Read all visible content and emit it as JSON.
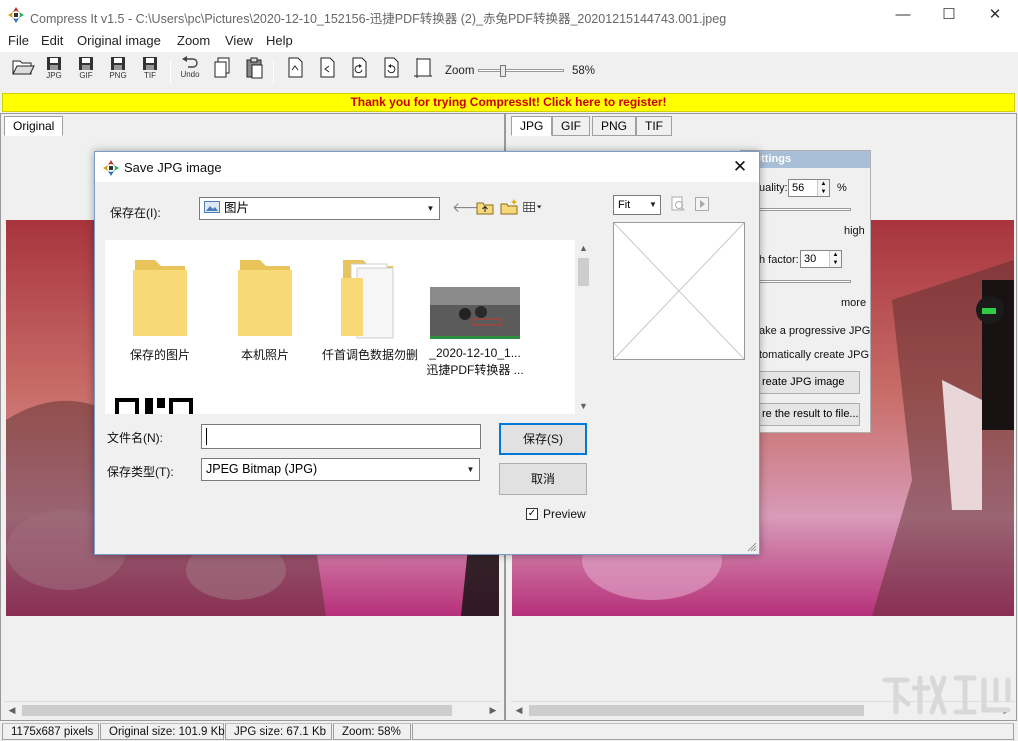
{
  "window": {
    "title": "Compress It v1.5 - C:\\Users\\pc\\Pictures\\2020-12-10_152156-迅捷PDF转换器 (2)_赤兔PDF转换器_20201215144743.001.jpeg",
    "minimize_glyph": "—",
    "maximize_glyph": "☐",
    "close_glyph": "✕"
  },
  "menu": {
    "items": [
      "File",
      "Edit",
      "Original image",
      "Zoom",
      "View",
      "Help"
    ]
  },
  "toolbar": {
    "buttons": [
      {
        "icon": "open-folder-icon",
        "label": ""
      },
      {
        "icon": "save-jpg-icon",
        "label": "JPG"
      },
      {
        "icon": "save-gif-icon",
        "label": "GIF"
      },
      {
        "icon": "save-png-icon",
        "label": "PNG"
      },
      {
        "icon": "save-tif-icon",
        "label": "TIF"
      },
      {
        "icon": "undo-icon",
        "label": "Undo"
      },
      {
        "icon": "copy-icon",
        "label": ""
      },
      {
        "icon": "paste-icon",
        "label": ""
      },
      {
        "icon": "flip-icon",
        "label": ""
      },
      {
        "icon": "mirror-icon",
        "label": ""
      },
      {
        "icon": "rotate-left-icon",
        "label": ""
      },
      {
        "icon": "rotate-right-icon",
        "label": ""
      },
      {
        "icon": "crop-icon",
        "label": ""
      }
    ],
    "zoom_label": "Zoom",
    "zoom_value": "58%",
    "zoom_level": 0.58
  },
  "banner": {
    "text": "Thank you for trying CompressIt! Click here to register!"
  },
  "left_pane": {
    "tab": "Original"
  },
  "right_pane": {
    "tabs": [
      "JPG",
      "GIF",
      "PNG",
      "TIF"
    ],
    "active_tab": "JPG"
  },
  "settings_panel": {
    "header": "ettings",
    "quality_label": "uality:",
    "quality_value": "56",
    "quality_unit": "%",
    "high_label": "high",
    "smooth_label": "h factor:",
    "smooth_value": "30",
    "more_label": "more",
    "progressive_label": "ake a progressive JPG",
    "auto_create_label": "tomatically create JPG",
    "create_button": "reate JPG image",
    "save_button": "re the result to file..."
  },
  "status_bar": {
    "dimensions": "1175x687 pixels",
    "original_size": "Original size: 101.9 Kb",
    "jpg_size": "JPG size: 67.1 Kb",
    "zoom": "Zoom: 58%"
  },
  "dialog": {
    "title": "Save JPG image",
    "close_glyph": "✕",
    "save_in_label": "保存在(I):",
    "save_in_value": "图片",
    "files": [
      {
        "name": "保存的图片",
        "type": "folder"
      },
      {
        "name": "本机照片",
        "type": "folder"
      },
      {
        "name": "仟首调色数据勿删",
        "type": "folder"
      },
      {
        "name_line1": "_2020-12-10_1...",
        "name_line2": "迅捷PDF转换器 ...",
        "type": "image"
      }
    ],
    "filename_label": "文件名(N):",
    "filename_value": "",
    "filetype_label": "保存类型(T):",
    "filetype_value": "JPEG Bitmap (JPG)",
    "save_button": "保存(S)",
    "cancel_button": "取消",
    "preview_label": "Preview",
    "preview_checked": true,
    "fit_value": "Fit"
  }
}
